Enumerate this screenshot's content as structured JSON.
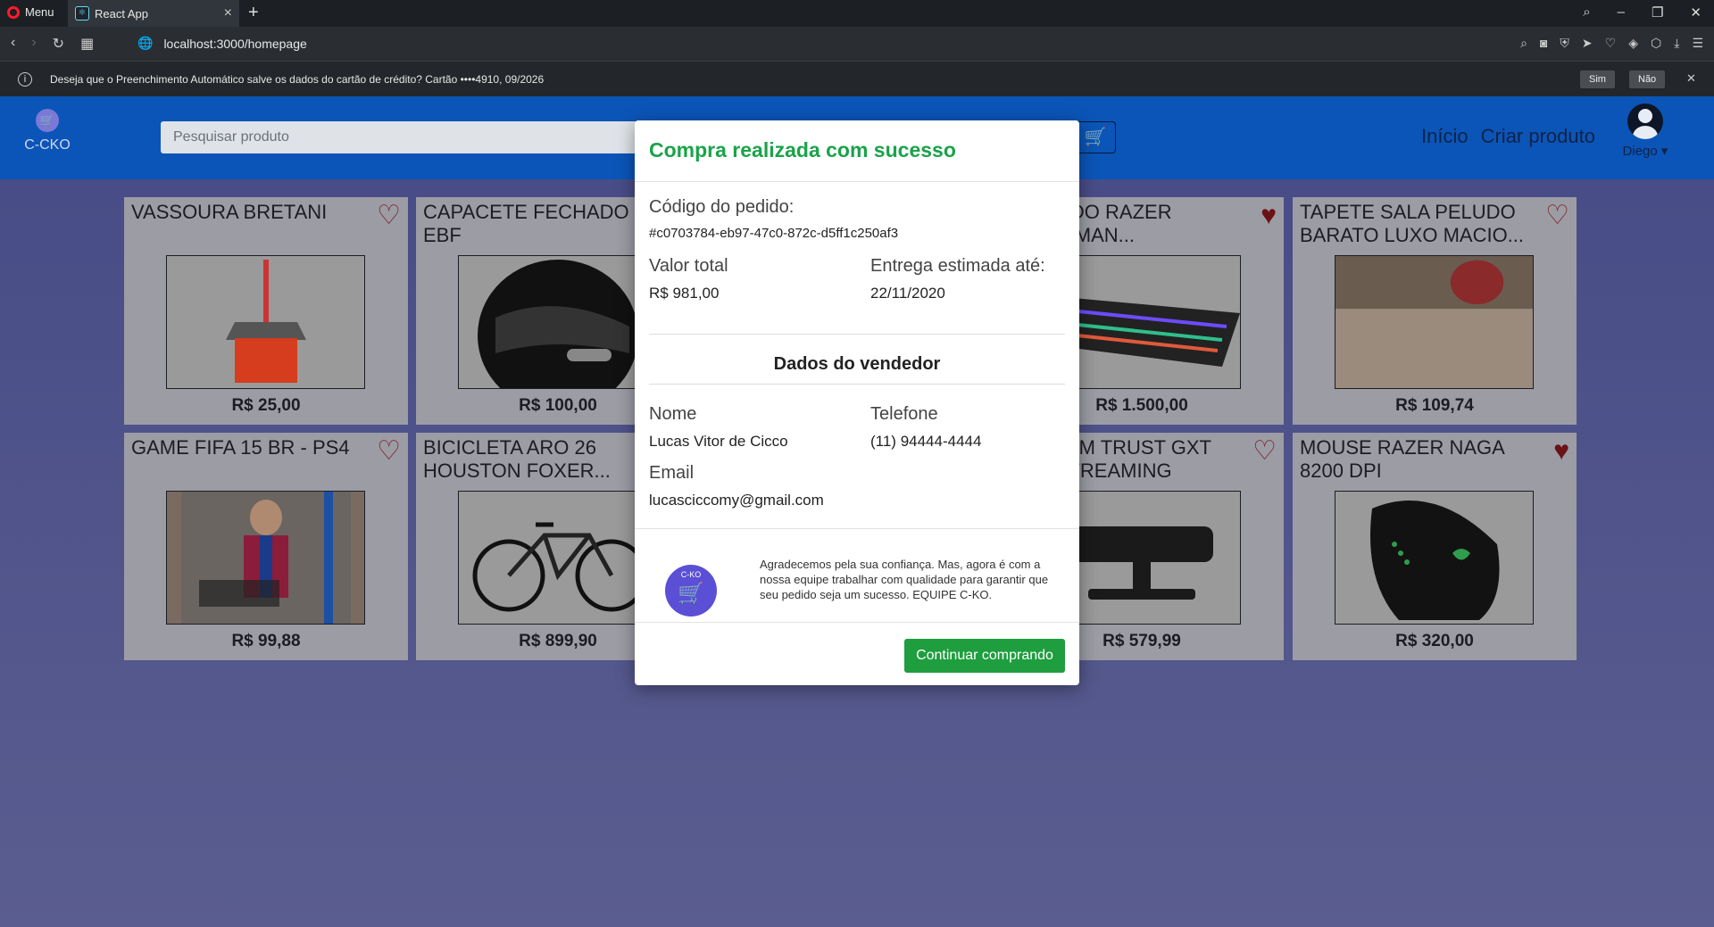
{
  "browser": {
    "menu_label": "Menu",
    "tab_title": "React App",
    "favicon_glyph": "⚛",
    "url": "localhost:3000/homepage",
    "infobar_text": "Deseja que o Preenchimento Automático salve os dados do cartão de crédito? Cartão  ••••4910, 09/2026",
    "infobar_yes": "Sim",
    "infobar_no": "Não"
  },
  "header": {
    "logo_text": "C-CKO",
    "search_placeholder": "Pesquisar produto",
    "nav": [
      "Início",
      "Criar produto"
    ],
    "user_name": "Diego ▾"
  },
  "products": [
    {
      "name": "VASSOURA BRETANI",
      "price": "R$ 25,00",
      "favorite": false,
      "image": "broom"
    },
    {
      "name": "CAPACETE FECHADO EBF",
      "price": "R$ 100,00",
      "favorite": false,
      "image": "helmet"
    },
    {
      "name": "TECLADO RAZER HUNTSMAN...",
      "price": "R$ 1.500,00",
      "favorite": true,
      "image": "keyboard"
    },
    {
      "name": "TAPETE SALA PELUDO BARATO LUXO MACIO...",
      "price": "R$ 109,74",
      "favorite": false,
      "image": "rug"
    },
    {
      "name": "GAME FIFA 15 BR - PS4",
      "price": "R$ 99,88",
      "favorite": false,
      "image": "fifa"
    },
    {
      "name": "BICICLETA ARO 26 HOUSTON FOXER...",
      "price": "R$ 899,90",
      "favorite": false,
      "image": "bike"
    },
    {
      "name": "WEBCAM TRUST GXT PRO STREAMING",
      "price": "R$ 579,99",
      "favorite": false,
      "image": "webcam"
    },
    {
      "name": "MOUSE RAZER NAGA 8200 DPI",
      "price": "R$ 320,00",
      "favorite": true,
      "image": "mouse"
    }
  ],
  "modal": {
    "title": "Compra realizada com sucesso",
    "order_code_label": "Código do pedido:",
    "order_code": "#c0703784-eb97-47c0-872c-d5ff1c250af3",
    "total_label": "Valor total",
    "total_value": "R$ 981,00",
    "delivery_label": "Entrega estimada até:",
    "delivery_value": "22/11/2020",
    "seller_section": "Dados do vendedor",
    "name_label": "Nome",
    "name_value": "Lucas Vitor de Cicco",
    "phone_label": "Telefone",
    "phone_value": "(11) 94444-4444",
    "email_label": "Email",
    "email_value": "lucasciccomy@gmail.com",
    "thanks_badge": "C-KO",
    "thanks_text": "Agradecemos pela sua confiança. Mas, agora é com a nossa equipe trabalhar com qualidade para garantir que seu pedido seja um sucesso. EQUIPE C-KO.",
    "continue_label": "Continuar comprando"
  },
  "colors": {
    "header_blue": "#0b55b8",
    "success_green": "#1aa34a",
    "button_green": "#1e9e3e"
  }
}
